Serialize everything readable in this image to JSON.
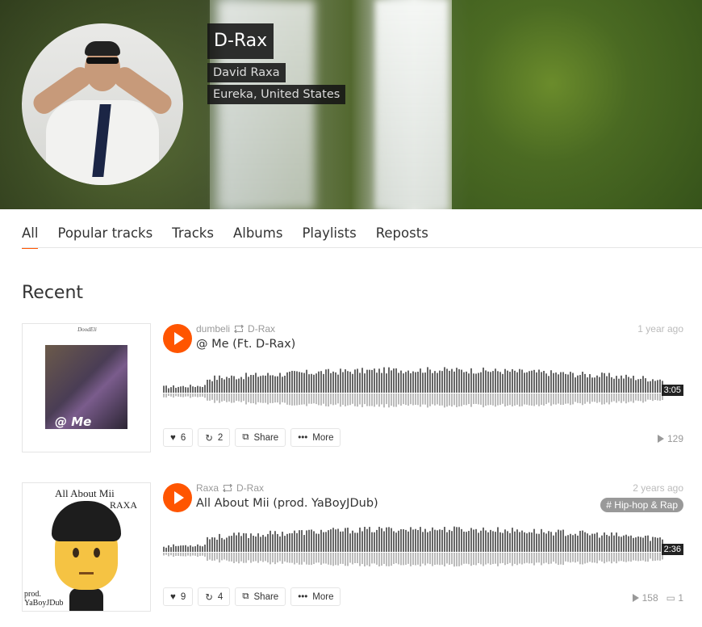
{
  "profile": {
    "username": "D-Rax",
    "real_name": "David Raxa",
    "location": "Eureka, United States"
  },
  "tabs": [
    {
      "label": "All",
      "active": true
    },
    {
      "label": "Popular tracks",
      "active": false
    },
    {
      "label": "Tracks",
      "active": false
    },
    {
      "label": "Albums",
      "active": false
    },
    {
      "label": "Playlists",
      "active": false
    },
    {
      "label": "Reposts",
      "active": false
    }
  ],
  "section_title": "Recent",
  "accent_color": "#ff5500",
  "tracks": [
    {
      "uploader": "dumbeli",
      "reposter": "D-Rax",
      "title": "@ Me (Ft. D-Rax)",
      "posted": "1 year ago",
      "duration": "3:05",
      "likes": "6",
      "reposts": "2",
      "share_label": "Share",
      "more_label": "More",
      "plays": "129",
      "art": {
        "header": "DoodEli",
        "overlay": "@ Me"
      }
    },
    {
      "uploader": "Raxa",
      "reposter": "D-Rax",
      "title": "All About Mii (prod. YaBoyJDub)",
      "posted": "2 years ago",
      "genre": "# Hip-hop & Rap",
      "duration": "2:36",
      "likes": "9",
      "reposts": "4",
      "share_label": "Share",
      "more_label": "More",
      "plays": "158",
      "comments": "1",
      "art": {
        "title": "All About Mii",
        "artist": "RAXA",
        "prod_line1": "prod.",
        "prod_line2": "YaBoyJDub"
      }
    }
  ]
}
